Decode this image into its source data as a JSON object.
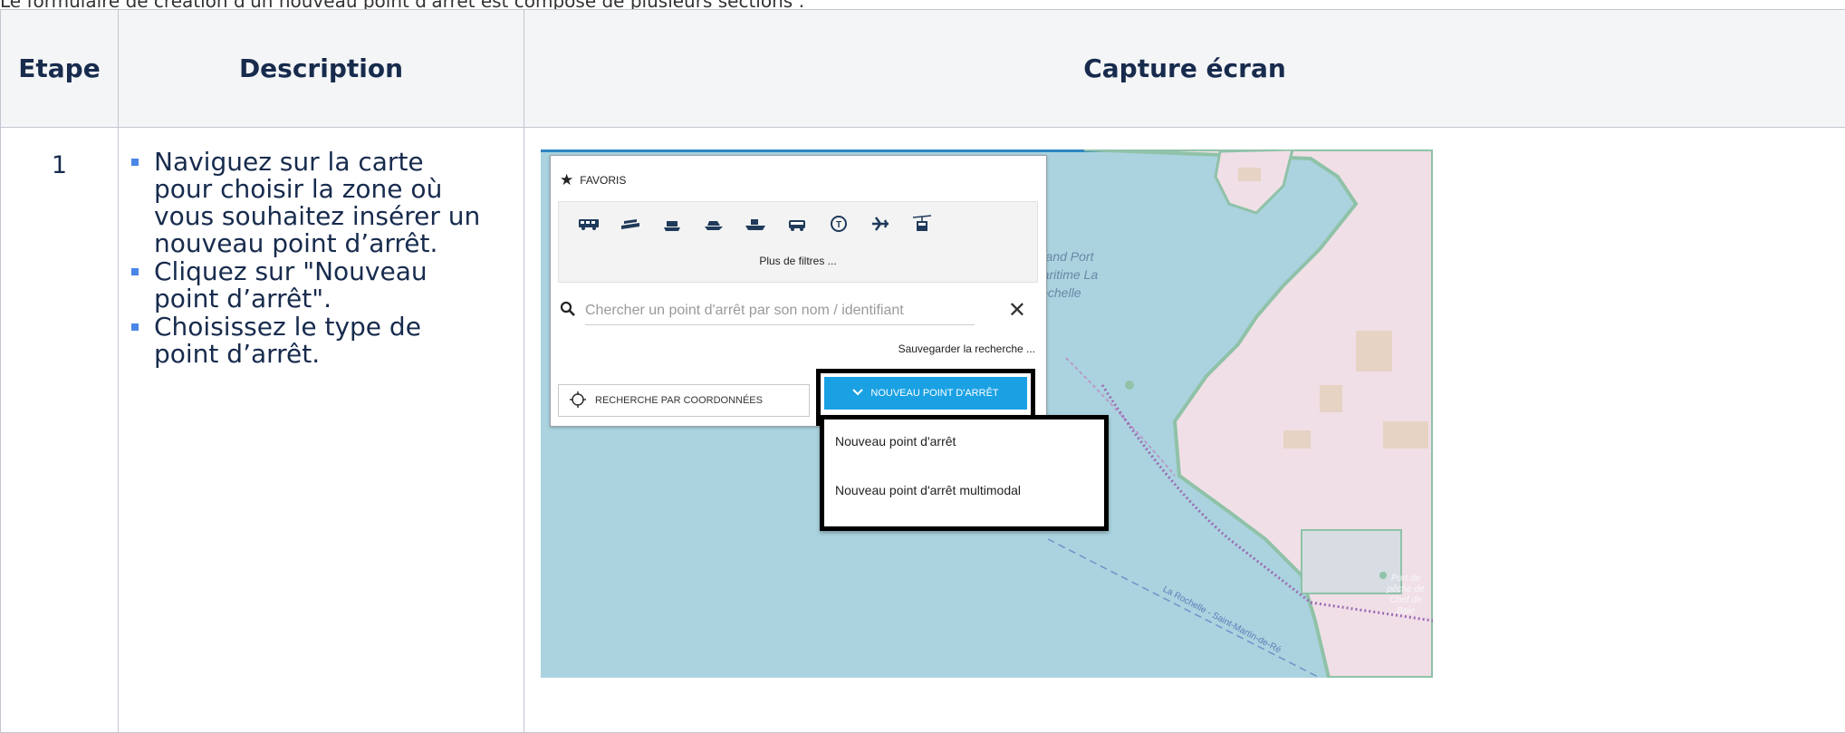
{
  "top_text": "Le formulaire de création d'un nouveau point d'arrêt est composé de plusieurs sections :",
  "table": {
    "headers": {
      "step": "Etape",
      "description": "Description",
      "capture": "Capture écran"
    },
    "rows": [
      {
        "step": "1",
        "bullets": [
          "Naviguez sur la carte pour choisir la zone où vous souhaitez insérer un nouveau point d’arrêt.",
          "Cliquez sur \"Nouveau point d’arrêt\".",
          "Choisissez le type de point d’arrêt."
        ]
      }
    ]
  },
  "screenshot": {
    "favorites_label": "FAVORIS",
    "transport_modes": [
      "bus-icon",
      "ferry-icon",
      "cable-car-icon",
      "boat-icon",
      "ship-icon",
      "coach-icon",
      "tram-icon",
      "airplane-icon",
      "gondola-icon"
    ],
    "more_filters": "Plus de filtres ...",
    "search_placeholder": "Chercher un point d'arrêt par son nom / identifiant",
    "save_search": "Sauvegarder la recherche ...",
    "coordinate_search": "RECHERCHE PAR COORDONNÉES",
    "new_stop_button": "NOUVEAU POINT D'ARRÊT",
    "dropdown_items": [
      "Nouveau point d'arrêt",
      "Nouveau point d'arrêt multimodal"
    ],
    "map_labels": {
      "port": "Grand Port Maritime La Rochelle",
      "fishing_port": "Port de pêche de Chef de Baie",
      "ferry": "La Rochelle - Saint-Martin-de-Ré"
    },
    "colors": {
      "sea": "#aad3df",
      "land": "#f1dfe7",
      "button": "#1aa1e4",
      "bullet": "#4a86e8"
    }
  }
}
